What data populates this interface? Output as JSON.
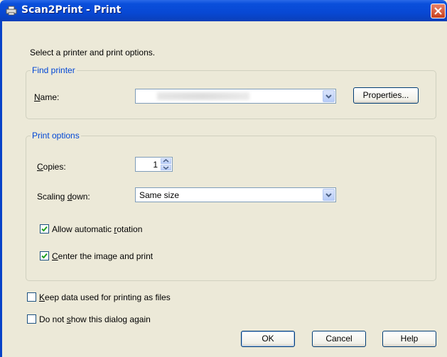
{
  "window": {
    "title": "Scan2Print - Print",
    "icons": {
      "app": "scanner-printer-icon",
      "close": "close-icon"
    }
  },
  "instruction": "Select a printer and print options.",
  "find_printer": {
    "legend": "Find printer",
    "name_label": "Name:",
    "printer_value": "",
    "properties_button": "Properties..."
  },
  "print_options": {
    "legend": "Print options",
    "copies_label": "Copies:",
    "copies_value": "1",
    "scaling_label": "Scaling down:",
    "scaling_value": "Same size",
    "allow_rotation": {
      "label": "Allow automatic rotation",
      "checked": true
    },
    "center_image": {
      "label": "Center the image and print",
      "checked": true
    }
  },
  "keep_data": {
    "label": "Keep data used for printing as files",
    "checked": false
  },
  "do_not_show": {
    "label": "Do not show this dialog again",
    "checked": false
  },
  "buttons": {
    "ok": "OK",
    "cancel": "Cancel",
    "help": "Help"
  },
  "colors": {
    "titlebar": "#0a4fdb",
    "legend": "#0046d5",
    "dialog_bg": "#ece9d8"
  }
}
